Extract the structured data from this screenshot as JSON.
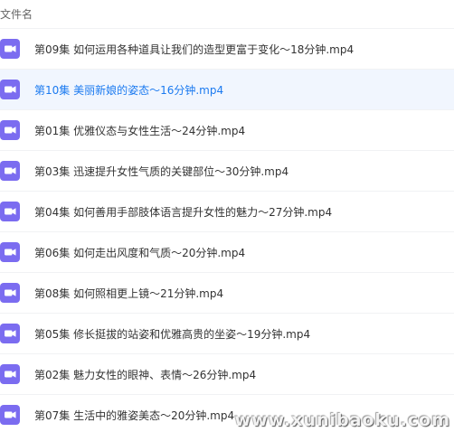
{
  "header": {
    "column_label": "文件名"
  },
  "colors": {
    "icon_purple": "#7b6cf0",
    "selected_text": "#1b7af0",
    "selected_bg": "#f1f6fe"
  },
  "files": [
    {
      "name": "第09集   如何运用各种道具让我们的造型更富于变化～18分钟.mp4",
      "icon": "video-file-icon",
      "selected": false
    },
    {
      "name": "第10集   美丽新娘的姿态～16分钟.mp4",
      "icon": "video-file-icon",
      "selected": true
    },
    {
      "name": "第01集   优雅仪态与女性生活～24分钟.mp4",
      "icon": "video-file-icon",
      "selected": false
    },
    {
      "name": "第03集   迅速提升女性气质的关键部位～30分钟.mp4",
      "icon": "video-file-icon",
      "selected": false
    },
    {
      "name": "第04集   如何善用手部肢体语言提升女性的魅力～27分钟.mp4",
      "icon": "video-file-icon",
      "selected": false
    },
    {
      "name": "第06集   如何走出风度和气质～20分钟.mp4",
      "icon": "video-file-icon",
      "selected": false
    },
    {
      "name": "第08集   如何照相更上镜～21分钟.mp4",
      "icon": "video-file-icon",
      "selected": false
    },
    {
      "name": "第05集   修长挺拔的站姿和优雅高贵的坐姿～19分钟.mp4",
      "icon": "video-file-icon",
      "selected": false
    },
    {
      "name": "第02集   魅力女性的眼神、表情～26分钟.mp4",
      "icon": "video-file-icon",
      "selected": false
    },
    {
      "name": "第07集   生活中的雅姿美态～20分钟.mp4",
      "icon": "video-file-icon",
      "selected": false
    }
  ],
  "watermark": "www.xunibaoku.com"
}
